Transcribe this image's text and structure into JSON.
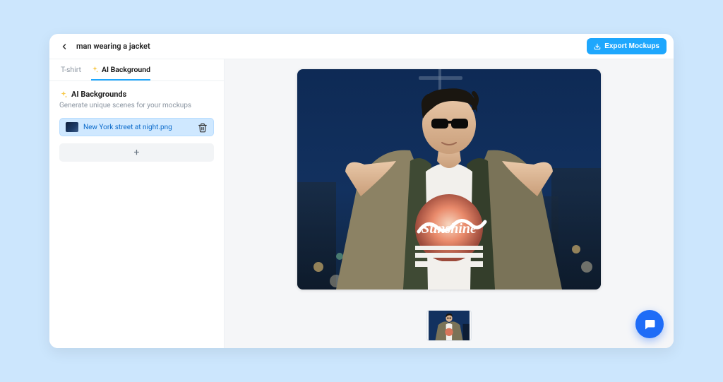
{
  "header": {
    "title": "man wearing a jacket",
    "export_label": "Export Mockups"
  },
  "tabs": {
    "tshirt": "T-shirt",
    "ai_background": "AI Background"
  },
  "panel": {
    "title": "AI Backgrounds",
    "subtitle": "Generate unique scenes for your mockups"
  },
  "background_item": {
    "name": "New York street at night.png"
  },
  "shirt_text": "Sunshine"
}
